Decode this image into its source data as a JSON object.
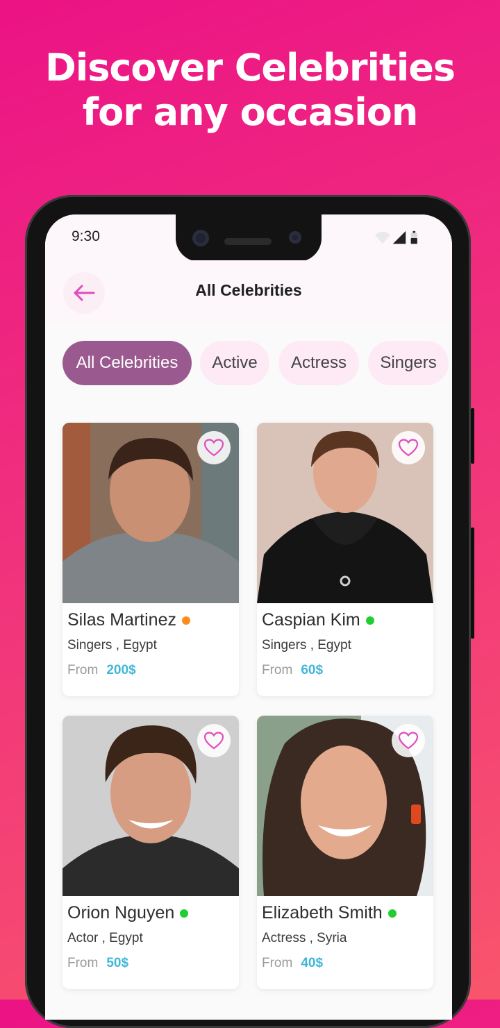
{
  "headline": {
    "line1": "Discover Celebrities",
    "line2": "for any occasion"
  },
  "status_bar": {
    "time": "9:30",
    "icons": [
      "wifi-icon",
      "cellular-signal-icon",
      "battery-icon"
    ]
  },
  "header": {
    "title": "All Celebrities",
    "back_icon": "arrow-left-icon"
  },
  "filters": [
    {
      "label": "All Celebrities",
      "active": true
    },
    {
      "label": "Active",
      "active": false
    },
    {
      "label": "Actress",
      "active": false
    },
    {
      "label": "Singers",
      "active": false
    }
  ],
  "colors": {
    "accent": "#9b5a8f",
    "chip_bg": "#feeaf5",
    "price": "#3fb7d9",
    "status_online": "#22cc33",
    "status_away": "#ff8c1a",
    "favorite": "#e14bbd"
  },
  "celebrities": [
    {
      "name": "Silas Martinez",
      "category": "Singers , Egypt",
      "from_label": "From",
      "price": "200$",
      "status": "away"
    },
    {
      "name": "Caspian Kim",
      "category": "Singers , Egypt",
      "from_label": "From",
      "price": "60$",
      "status": "online"
    },
    {
      "name": "Orion Nguyen",
      "category": "Actor , Egypt",
      "from_label": "From",
      "price": "50$",
      "status": "online"
    },
    {
      "name": "Elizabeth Smith",
      "category": "Actress , Syria",
      "from_label": "From",
      "price": "40$",
      "status": "online"
    }
  ]
}
